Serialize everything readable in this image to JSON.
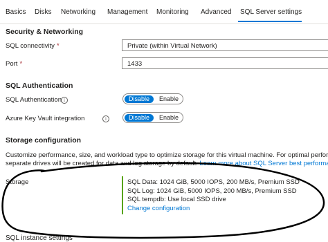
{
  "tabs": [
    "Basics",
    "Disks",
    "Networking",
    "Management",
    "Monitoring",
    "Advanced",
    "SQL Server settings"
  ],
  "security": {
    "heading": "Security & Networking",
    "connectivity_label": "SQL connectivity",
    "connectivity_value": "Private (within Virtual Network)",
    "port_label": "Port",
    "port_value": "1433",
    "required_mark": "*"
  },
  "auth": {
    "heading": "SQL Authentication",
    "sql_auth_label": "SQL Authentication",
    "akv_label": "Azure Key Vault integration",
    "info_glyph": "i",
    "disable": "Disable",
    "enable": "Enable"
  },
  "storage": {
    "heading": "Storage configuration",
    "desc_line1": "Customize performance, size, and workload type to optimize storage for this virtual machine. For optimal perfor",
    "desc_line2_text": "separate drives will be created for data and log storage by default.",
    "desc_link": "Learn more about SQL Server best performa",
    "label": "Storage",
    "data": "SQL Data: 1024 GiB, 5000 IOPS, 200 MB/s, Premium SSD",
    "log": "SQL Log: 1024 GiB, 5000 IOPS, 200 MB/s, Premium SSD",
    "tempdb": "SQL tempdb: Use local SSD drive",
    "change_link": "Change configuration",
    "accent_color": "#57a300"
  },
  "instance": {
    "heading": "SQL instance settings"
  },
  "colors": {
    "accent": "#0078d4",
    "annotation_ink": "#000000"
  }
}
